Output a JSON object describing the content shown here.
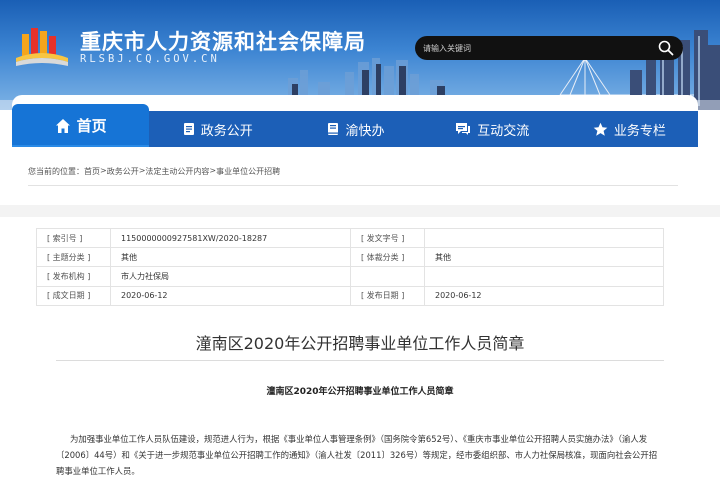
{
  "header": {
    "title": "重庆市人力资源和社会保障局",
    "subtitle": "RLSBJ.CQ.GOV.CN",
    "search_placeholder": "请输入关键词"
  },
  "nav": {
    "items": [
      {
        "label": "首页",
        "icon": "home-icon",
        "active": true
      },
      {
        "label": "政务公开",
        "icon": "document-icon",
        "active": false
      },
      {
        "label": "渝快办",
        "icon": "book-icon",
        "active": false
      },
      {
        "label": "互动交流",
        "icon": "chat-icon",
        "active": false
      },
      {
        "label": "业务专栏",
        "icon": "star-icon",
        "active": false
      }
    ]
  },
  "breadcrumb": {
    "prefix": "您当前的位置：",
    "items": [
      "首页",
      "政务公开",
      "法定主动公开内容",
      "事业单位公开招聘"
    ],
    "separator": ">"
  },
  "meta": {
    "rows": [
      {
        "k1": "[ 索引号 ]",
        "v1": "1150000000927581XW/2020-18287",
        "k2": "[ 发文字号 ]",
        "v2": ""
      },
      {
        "k1": "[ 主题分类 ]",
        "v1": "其他",
        "k2": "[ 体裁分类 ]",
        "v2": "其他"
      },
      {
        "k1": "[ 发布机构 ]",
        "v1": "市人力社保局",
        "k2": "",
        "v2": ""
      },
      {
        "k1": "[ 成文日期 ]",
        "v1": "2020-06-12",
        "k2": "[ 发布日期 ]",
        "v2": "2020-06-12"
      }
    ]
  },
  "article": {
    "title": "潼南区2020年公开招聘事业单位工作人员简章",
    "subtitle": "潼南区2020年公开招聘事业单位工作人员简章",
    "paragraph": "为加强事业单位工作人员队伍建设，规范进人行为，根据《事业单位人事管理条例》（国务院令第652号）、《重庆市事业单位公开招聘人员实施办法》（渝人发〔2006〕44号）和《关于进一步规范事业单位公开招聘工作的通知》（渝人社发〔2011〕326号）等规定，经市委组织部、市人力社保局核准，现面向社会公开招聘事业单位工作人员。"
  },
  "colors": {
    "nav_bg": "#1c5fb7",
    "nav_active": "#1674d6",
    "banner_top": "#1a5fb5"
  }
}
